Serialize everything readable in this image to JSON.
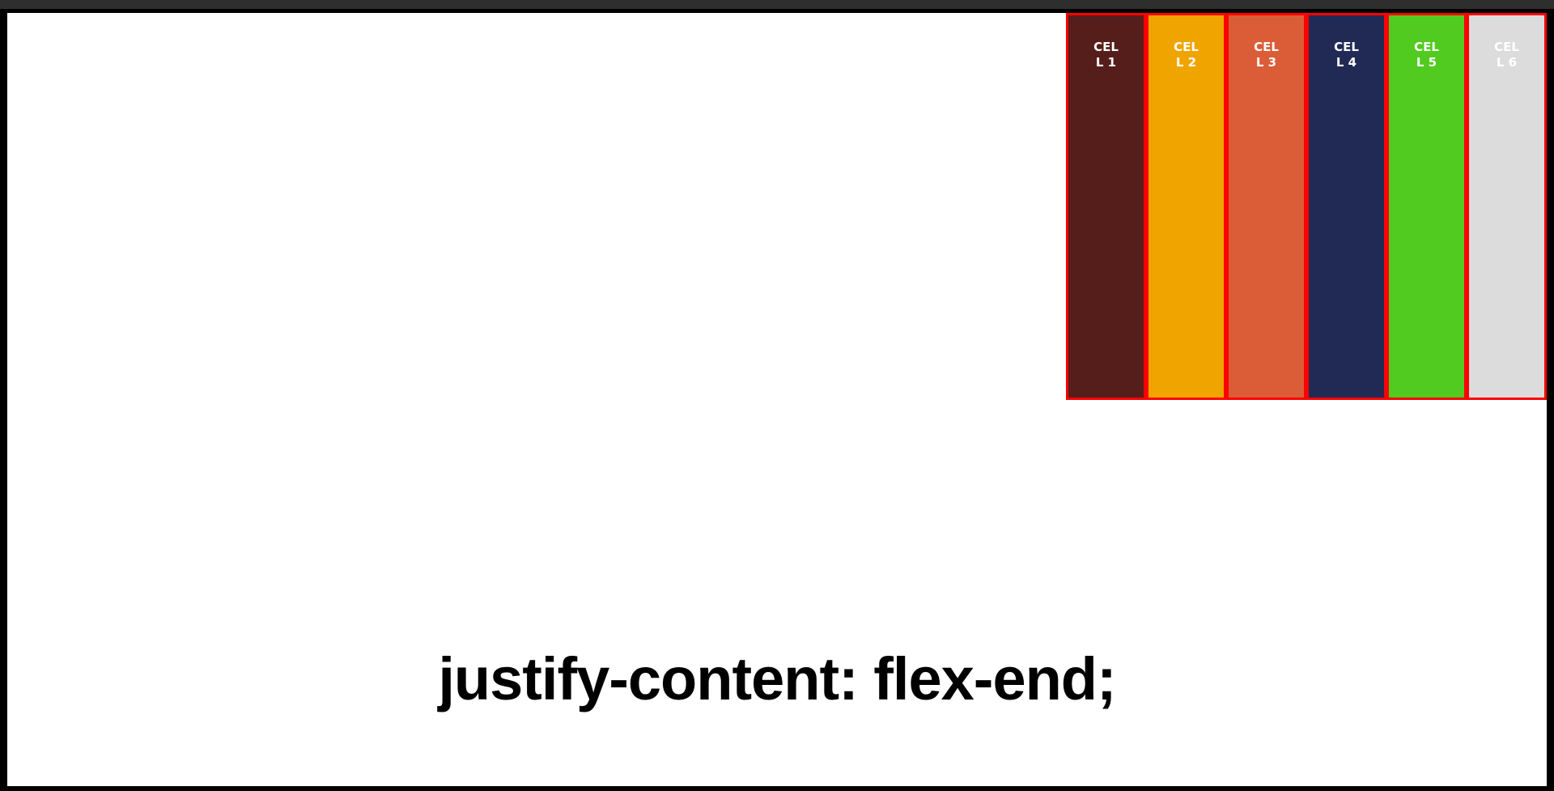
{
  "caption": "justify-content: flex-end;",
  "cells": [
    {
      "label": "CELL 1",
      "bg": "#561e1b",
      "fg": "#ffffff"
    },
    {
      "label": "CELL 2",
      "bg": "#f0a400",
      "fg": "#ffffff"
    },
    {
      "label": "CELL 3",
      "bg": "#db5d38",
      "fg": "#ffffff"
    },
    {
      "label": "CELL 4",
      "bg": "#212a55",
      "fg": "#ffffff"
    },
    {
      "label": "CELL 5",
      "bg": "#51cb20",
      "fg": "#ffffff"
    },
    {
      "label": "CELL 6",
      "bg": "#dcdcdc",
      "fg": "#ffffff"
    }
  ],
  "colors": {
    "cell_border": "#ff0000",
    "stage_background": "#ffffff",
    "frame": "#000000",
    "topbar": "#2e2e2e"
  }
}
